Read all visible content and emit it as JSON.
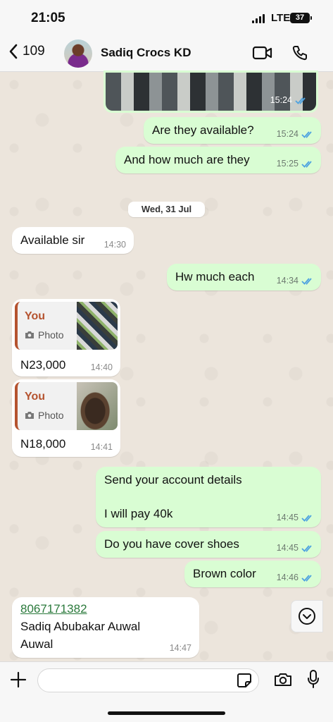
{
  "status_bar": {
    "time": "21:05",
    "network": "LTE",
    "battery": "37"
  },
  "header": {
    "back_count": "109",
    "contact_name": "Sadiq Crocs KD"
  },
  "messages": [
    {
      "type": "photo",
      "direction": "out",
      "time": "15:24"
    },
    {
      "direction": "out",
      "text": "Are they available?",
      "time": "15:24"
    },
    {
      "direction": "out",
      "text": "And how much are they",
      "time": "15:25"
    },
    {
      "type": "date",
      "text": "Wed, 31 Jul"
    },
    {
      "direction": "in",
      "text": "Available sir",
      "time": "14:30"
    },
    {
      "direction": "out",
      "text": "Hw much each",
      "time": "14:34"
    },
    {
      "direction": "in",
      "reply_name": "You",
      "reply_type": "Photo",
      "text": "N23,000",
      "time": "14:40"
    },
    {
      "direction": "in",
      "reply_name": "You",
      "reply_type": "Photo",
      "text": "N18,000",
      "time": "14:41"
    },
    {
      "direction": "out",
      "line1": "Send your account details",
      "line2": "I will pay 40k",
      "time": "14:45"
    },
    {
      "direction": "out",
      "text": "Do you have cover shoes",
      "time": "14:45"
    },
    {
      "direction": "out",
      "text": "Brown color",
      "time": "14:46"
    },
    {
      "direction": "in",
      "link": "8067171382",
      "line1": "Sadiq Abubakar Auwal",
      "line2": "Auwal",
      "time": "14:47"
    }
  ],
  "composer": {
    "value": "",
    "placeholder": ""
  },
  "colors": {
    "outgoing_bubble": "#d9fdd3",
    "incoming_bubble": "#ffffff",
    "read_ticks": "#4fa3e0",
    "reply_accent": "#b5532f"
  }
}
